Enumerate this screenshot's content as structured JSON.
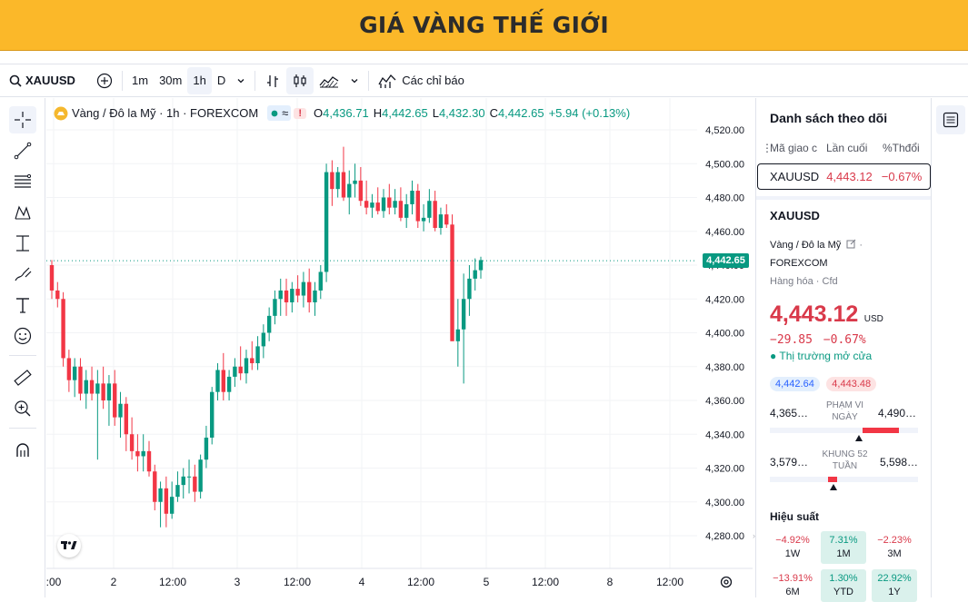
{
  "banner": {
    "title": "GIÁ VÀNG THẾ GIỚI"
  },
  "toolbar": {
    "symbol": "XAUUSD",
    "intervals": [
      "1m",
      "30m",
      "1h",
      "D"
    ],
    "indicators_label": "Các chỉ báo"
  },
  "legend": {
    "name": "Vàng / Đô la Mỹ · 1h · FOREXCOM",
    "o_label": "O",
    "o_val": "4,436.71",
    "h_label": "H",
    "h_val": "4,442.65",
    "l_label": "L",
    "l_val": "4,432.30",
    "c_label": "C",
    "c_val": "4,442.65",
    "change": "+5.94 (+0.13%)",
    "badge_excl": "!"
  },
  "price_tag": "4,442.65",
  "colors": {
    "up": "#089981",
    "down": "#f23645",
    "banner": "#fbb829"
  },
  "chart_data": {
    "type": "candlestick",
    "symbol": "XAUUSD",
    "interval": "1h",
    "ylim": [
      4270,
      4530
    ],
    "y_ticks": [
      "4,520.00",
      "4,500.00",
      "4,480.00",
      "4,460.00",
      "4,440.00",
      "4,420.00",
      "4,400.00",
      "4,380.00",
      "4,360.00",
      "4,340.00",
      "4,320.00",
      "4,300.00",
      "4,280.00"
    ],
    "y_tick_values": [
      4520,
      4500,
      4480,
      4460,
      4440,
      4420,
      4400,
      4380,
      4360,
      4340,
      4320,
      4300,
      4280
    ],
    "x_ticks": [
      ":00",
      "2",
      "12:00",
      "3",
      "12:00",
      "4",
      "12:00",
      "5",
      "12:00",
      "8",
      "12:00"
    ],
    "last_price": 4442.65,
    "candles": [
      [
        4440,
        4443,
        4420,
        4425
      ],
      [
        4425,
        4430,
        4415,
        4420
      ],
      [
        4420,
        4424,
        4380,
        4385
      ],
      [
        4385,
        4390,
        4365,
        4372
      ],
      [
        4372,
        4385,
        4362,
        4380
      ],
      [
        4380,
        4385,
        4360,
        4364
      ],
      [
        4364,
        4378,
        4355,
        4372
      ],
      [
        4372,
        4380,
        4360,
        4364
      ],
      [
        4364,
        4378,
        4325,
        4370
      ],
      [
        4370,
        4380,
        4355,
        4360
      ],
      [
        4360,
        4375,
        4345,
        4370
      ],
      [
        4370,
        4378,
        4345,
        4350
      ],
      [
        4350,
        4365,
        4338,
        4358
      ],
      [
        4358,
        4362,
        4330,
        4340
      ],
      [
        4340,
        4350,
        4325,
        4330
      ],
      [
        4330,
        4340,
        4318,
        4327
      ],
      [
        4327,
        4340,
        4318,
        4330
      ],
      [
        4330,
        4336,
        4315,
        4318
      ],
      [
        4318,
        4322,
        4295,
        4300
      ],
      [
        4300,
        4312,
        4285,
        4308
      ],
      [
        4308,
        4315,
        4285,
        4293
      ],
      [
        4293,
        4312,
        4290,
        4303
      ],
      [
        4303,
        4318,
        4300,
        4310
      ],
      [
        4310,
        4320,
        4302,
        4315
      ],
      [
        4315,
        4325,
        4305,
        4315
      ],
      [
        4315,
        4322,
        4300,
        4306
      ],
      [
        4306,
        4328,
        4302,
        4325
      ],
      [
        4325,
        4345,
        4320,
        4338
      ],
      [
        4338,
        4368,
        4334,
        4365
      ],
      [
        4365,
        4382,
        4360,
        4378
      ],
      [
        4378,
        4388,
        4360,
        4365
      ],
      [
        4365,
        4378,
        4360,
        4374
      ],
      [
        4374,
        4385,
        4368,
        4380
      ],
      [
        4380,
        4392,
        4372,
        4376
      ],
      [
        4376,
        4390,
        4370,
        4385
      ],
      [
        4385,
        4395,
        4378,
        4382
      ],
      [
        4382,
        4398,
        4378,
        4392
      ],
      [
        4392,
        4405,
        4385,
        4400
      ],
      [
        4400,
        4415,
        4395,
        4410
      ],
      [
        4410,
        4425,
        4405,
        4420
      ],
      [
        4420,
        4432,
        4410,
        4425
      ],
      [
        4425,
        4432,
        4410,
        4418
      ],
      [
        4418,
        4430,
        4412,
        4426
      ],
      [
        4426,
        4434,
        4418,
        4422
      ],
      [
        4422,
        4436,
        4415,
        4430
      ],
      [
        4430,
        4438,
        4412,
        4418
      ],
      [
        4418,
        4430,
        4410,
        4425
      ],
      [
        4425,
        4440,
        4420,
        4436
      ],
      [
        4436,
        4500,
        4430,
        4495
      ],
      [
        4495,
        4502,
        4475,
        4485
      ],
      [
        4485,
        4498,
        4480,
        4495
      ],
      [
        4495,
        4510,
        4478,
        4480
      ],
      [
        4480,
        4496,
        4470,
        4488
      ],
      [
        4488,
        4500,
        4480,
        4490
      ],
      [
        4490,
        4498,
        4475,
        4478
      ],
      [
        4478,
        4490,
        4470,
        4474
      ],
      [
        4474,
        4482,
        4468,
        4477
      ],
      [
        4477,
        4486,
        4470,
        4472
      ],
      [
        4472,
        4485,
        4468,
        4480
      ],
      [
        4480,
        4488,
        4470,
        4474
      ],
      [
        4474,
        4485,
        4470,
        4478
      ],
      [
        4478,
        4486,
        4466,
        4468
      ],
      [
        4468,
        4482,
        4462,
        4476
      ],
      [
        4476,
        4490,
        4470,
        4484
      ],
      [
        4484,
        4488,
        4462,
        4466
      ],
      [
        4466,
        4476,
        4460,
        4468
      ],
      [
        4468,
        4485,
        4465,
        4478
      ],
      [
        4478,
        4484,
        4460,
        4462
      ],
      [
        4462,
        4474,
        4458,
        4470
      ],
      [
        4470,
        4476,
        4462,
        4464
      ],
      [
        4464,
        4470,
        4430,
        4395
      ],
      [
        4395,
        4420,
        4380,
        4402
      ],
      [
        4402,
        4435,
        4370,
        4420
      ],
      [
        4420,
        4440,
        4410,
        4432
      ],
      [
        4432,
        4444,
        4425,
        4437
      ],
      [
        4437,
        4445,
        4432,
        4443
      ]
    ]
  },
  "watchlist": {
    "title": "Danh sách theo dõi",
    "col_symbol": "Mã giao c",
    "col_last": "Lần cuối",
    "col_change": "%Thđổi",
    "row": {
      "symbol": "XAUUSD",
      "last": "4,443.12",
      "change": "−0.67%"
    }
  },
  "details": {
    "symbol": "XAUUSD",
    "name": "Vàng / Đô la Mỹ",
    "exchange": "FOREXCOM",
    "category": "Hàng hóa",
    "type": "Cfd",
    "price": "4,443.12",
    "currency": "USD",
    "change": "−29.85",
    "change_pct": "−0.67%",
    "market_status": "Thị trường mở cửa",
    "bid": "4,442.64",
    "ask": "4,443.48",
    "day_low": "4,365…",
    "day_range_label": "PHẠM VI NGÀY",
    "day_high": "4,490…",
    "wk52_low": "3,579…",
    "wk52_label": "KHUNG 52 TUẦN",
    "wk52_high": "5,598…",
    "day_range_position": 0.6,
    "wk52_position": 0.43
  },
  "performance": {
    "title": "Hiệu suất",
    "items": [
      {
        "value": "−4.92%",
        "label": "1W",
        "trend": "down"
      },
      {
        "value": "7.31%",
        "label": "1M",
        "trend": "up"
      },
      {
        "value": "−2.23%",
        "label": "3M",
        "trend": "down"
      },
      {
        "value": "−13.91%",
        "label": "6M",
        "trend": "down"
      },
      {
        "value": "1.30%",
        "label": "YTD",
        "trend": "up"
      },
      {
        "value": "22.92%",
        "label": "1Y",
        "trend": "up"
      }
    ]
  }
}
